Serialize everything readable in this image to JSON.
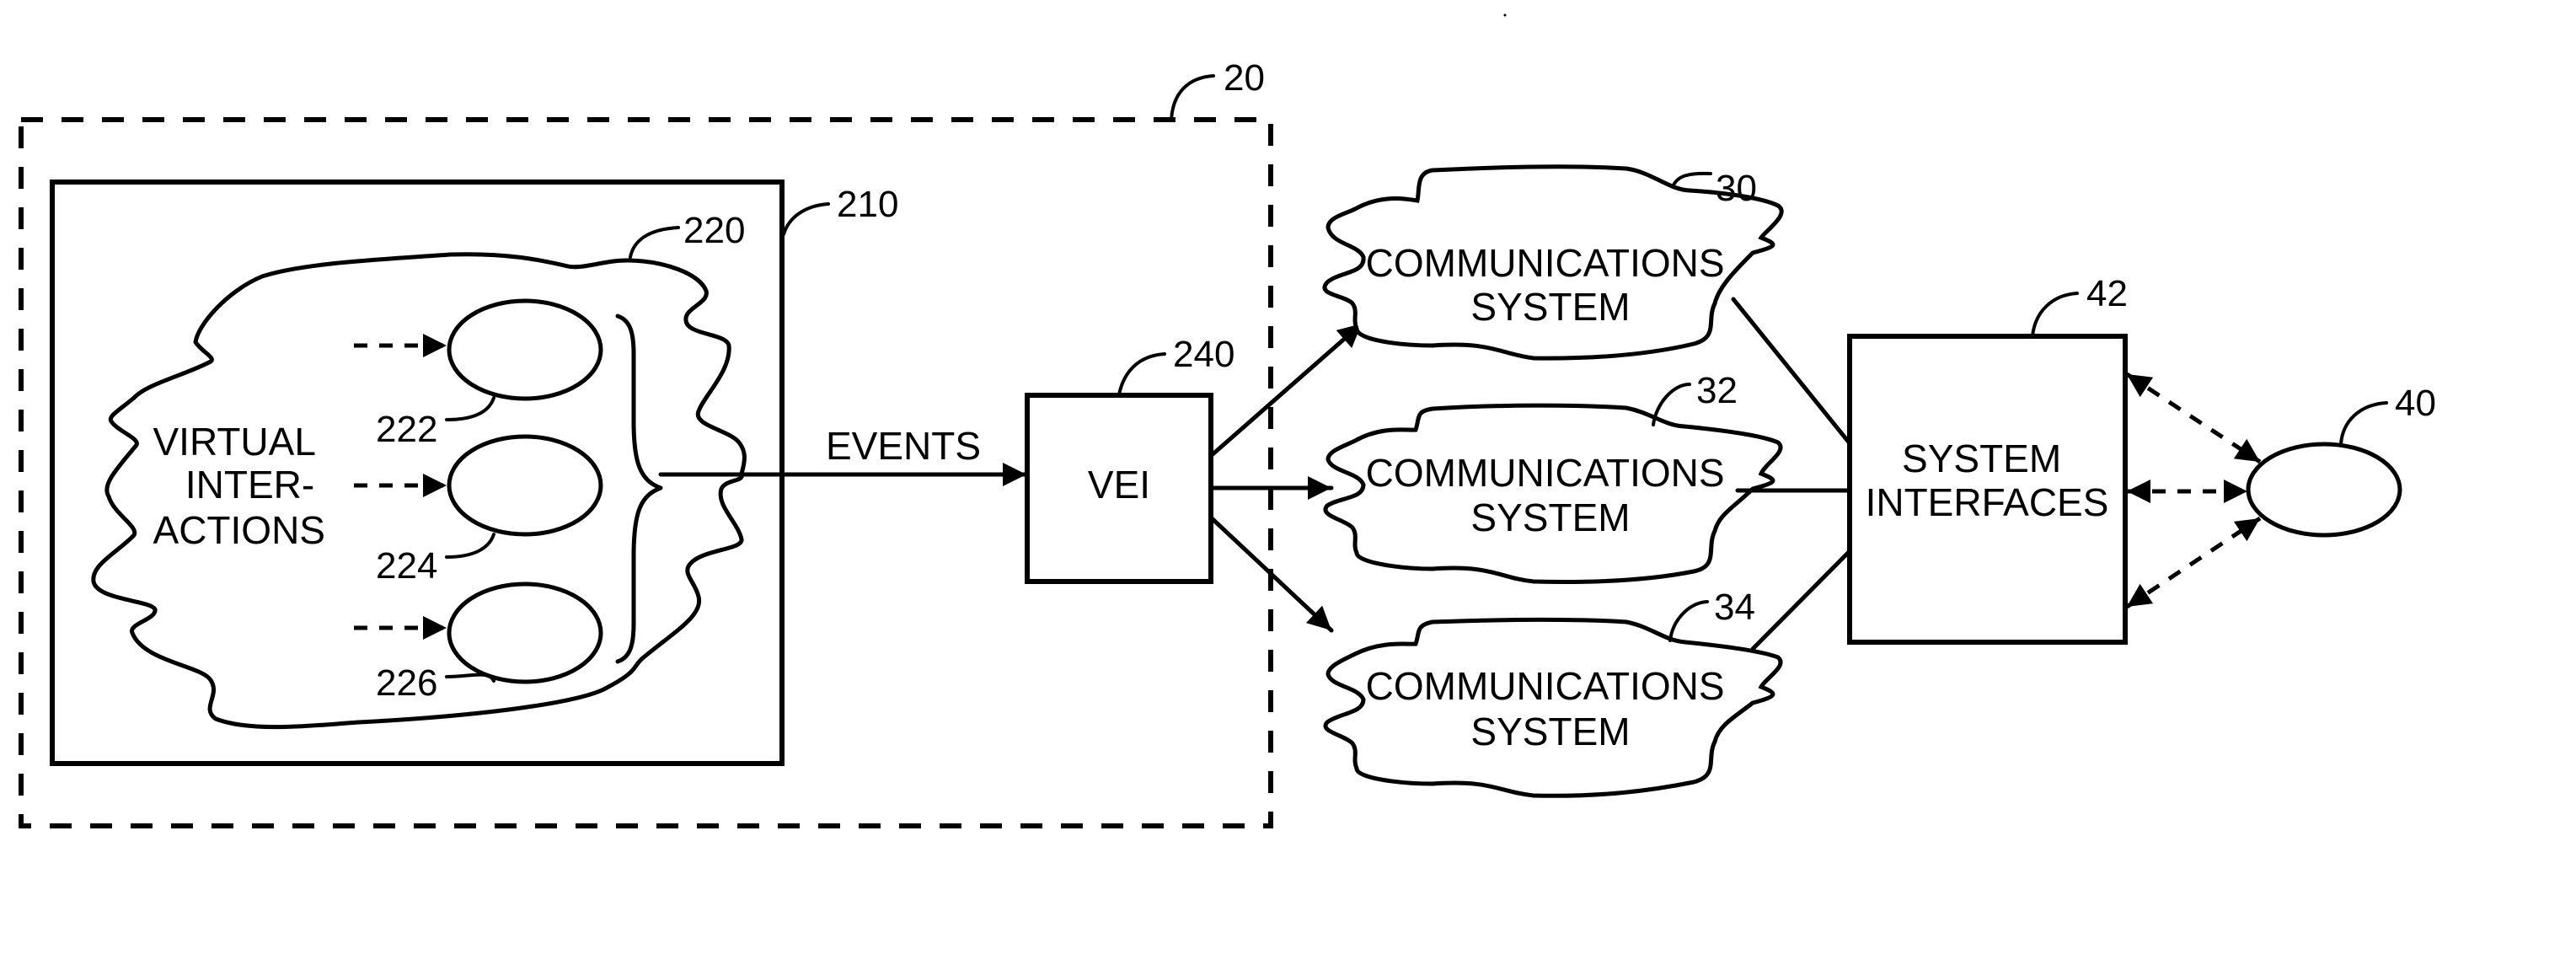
{
  "figure": {
    "type": "block-diagram",
    "stroke_color": "#000000",
    "background_color": "#ffffff"
  },
  "system": {
    "ref": "20",
    "border": "dashed"
  },
  "virtual_environment": {
    "ref": "210",
    "cloud": {
      "ref": "220",
      "label_lines": [
        "VIRTUAL",
        "INTER-",
        "ACTIONS"
      ],
      "interactions": [
        {
          "ref": "222"
        },
        {
          "ref": "224"
        },
        {
          "ref": "226"
        }
      ]
    }
  },
  "events_label": "EVENTS",
  "vei": {
    "ref": "240",
    "label": "VEI"
  },
  "communications_systems": [
    {
      "ref": "30",
      "label_lines": [
        "COMMUNICATIONS",
        "SYSTEM"
      ]
    },
    {
      "ref": "32",
      "label_lines": [
        "COMMUNICATIONS",
        "SYSTEM"
      ]
    },
    {
      "ref": "34",
      "label_lines": [
        "COMMUNICATIONS",
        "SYSTEM"
      ]
    }
  ],
  "system_interfaces": {
    "ref": "42",
    "label_lines": [
      "SYSTEM",
      "INTERFACES"
    ]
  },
  "external_entity": {
    "ref": "40",
    "label": ""
  },
  "connections": [
    {
      "from": "222",
      "to": "222",
      "style": "dashed-arrow-in"
    },
    {
      "from": "224",
      "to": "224",
      "style": "dashed-arrow-in"
    },
    {
      "from": "226",
      "to": "226",
      "style": "dashed-arrow-in"
    },
    {
      "from": "220",
      "to": "240",
      "label": "EVENTS",
      "style": "solid-arrow"
    },
    {
      "from": "240",
      "to": "30",
      "style": "solid-arrow"
    },
    {
      "from": "240",
      "to": "32",
      "style": "solid-arrow"
    },
    {
      "from": "240",
      "to": "34",
      "style": "solid-arrow"
    },
    {
      "from": "30",
      "to": "42",
      "style": "solid-line"
    },
    {
      "from": "32",
      "to": "42",
      "style": "solid-line"
    },
    {
      "from": "34",
      "to": "42",
      "style": "solid-line"
    },
    {
      "from": "42",
      "to": "40",
      "style": "dashed-double-arrow"
    },
    {
      "from": "42",
      "to": "40",
      "style": "dashed-double-arrow"
    },
    {
      "from": "42",
      "to": "40",
      "style": "dashed-double-arrow"
    }
  ]
}
